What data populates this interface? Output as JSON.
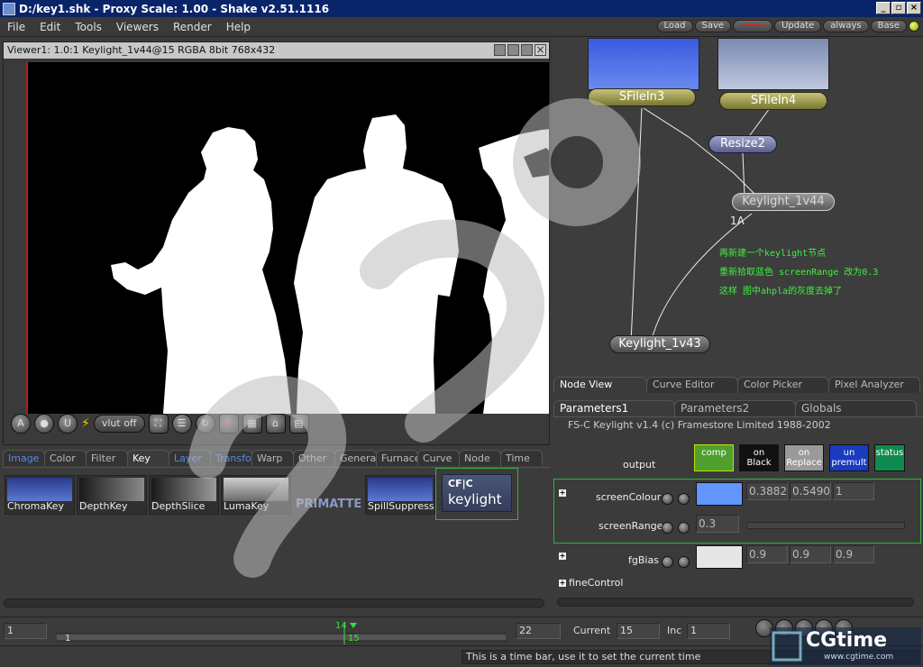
{
  "window": {
    "title": "D:/key1.shk - Proxy Scale: 1.00 - Shake v2.51.1116"
  },
  "menu": [
    "File",
    "Edit",
    "Tools",
    "Viewers",
    "Render",
    "Help"
  ],
  "top_buttons": {
    "load": "Load",
    "save": "Save",
    "update": "Update",
    "always": "always",
    "base": "Base"
  },
  "viewer": {
    "header": "Viewer1: 1.0:1 Keylight_1v44@15 RGBA 8bit 768x432",
    "toolbar": {
      "a_label": "A",
      "u_label": "U",
      "vlut": "vlut off"
    }
  },
  "tool_tabs": [
    "Image",
    "Color",
    "Filter",
    "Key",
    "Layer",
    "Transform",
    "Warp",
    "Other",
    "Generate",
    "Furnace",
    "Curve",
    "Node",
    "Time"
  ],
  "tools": [
    {
      "label": "ChromaKey"
    },
    {
      "label": "DepthKey"
    },
    {
      "label": "DepthSlice"
    },
    {
      "label": "LumaKey"
    },
    {
      "label": "PRIMATTE"
    },
    {
      "label": "SpillSuppress"
    }
  ],
  "keylight_tool": {
    "cf": "CF|C",
    "name": "keylight"
  },
  "nodes": {
    "sfilein3": "SFileIn3",
    "sfilein4": "SFileIn4",
    "resize2": "Resize2",
    "keylight44": "Keylight_1v44",
    "keylight43": "Keylight_1v43",
    "k44_sub": "1A"
  },
  "annotation": [
    "再新建一个keylight节点",
    "重新拾取蓝色 screenRange 改为0.3",
    "这样 图中ahpla的灰度去掉了"
  ],
  "view_tabs": [
    "Node View",
    "Curve Editor",
    "Color Picker",
    "Pixel Analyzer"
  ],
  "param_tabs": [
    "Parameters1",
    "Parameters2",
    "Globals"
  ],
  "params": {
    "copyright": "FS-C Keylight v1.4 (c) Framestore Limited 1988-2002",
    "output_label": "output",
    "output_buttons": [
      {
        "label": "comp"
      },
      {
        "label": "on Black"
      },
      {
        "label": "on Replace"
      },
      {
        "label": "un premult"
      },
      {
        "label": "status"
      }
    ],
    "screenColour": {
      "label": "screenColour",
      "values": [
        "0.3882",
        "0.5490",
        "1"
      ],
      "color": "#6395ff"
    },
    "screenRange": {
      "label": "screenRange",
      "value": "0.3"
    },
    "fgBias": {
      "label": "fgBias",
      "values": [
        "0.9",
        "0.9",
        "0.9"
      ],
      "color": "#e6e6e6"
    },
    "fineControl": "fineControl"
  },
  "timebar": {
    "start": "1",
    "end": "22",
    "current_label": "Current",
    "current": "15",
    "inc_label": "Inc",
    "inc": "1",
    "marker_top": "14",
    "marker_bottom": "15",
    "track_start": "1"
  },
  "status_help": "This is a time bar, use it to set the current time",
  "logo": {
    "name": "CGtime",
    "url": "www.cgtime.com"
  }
}
